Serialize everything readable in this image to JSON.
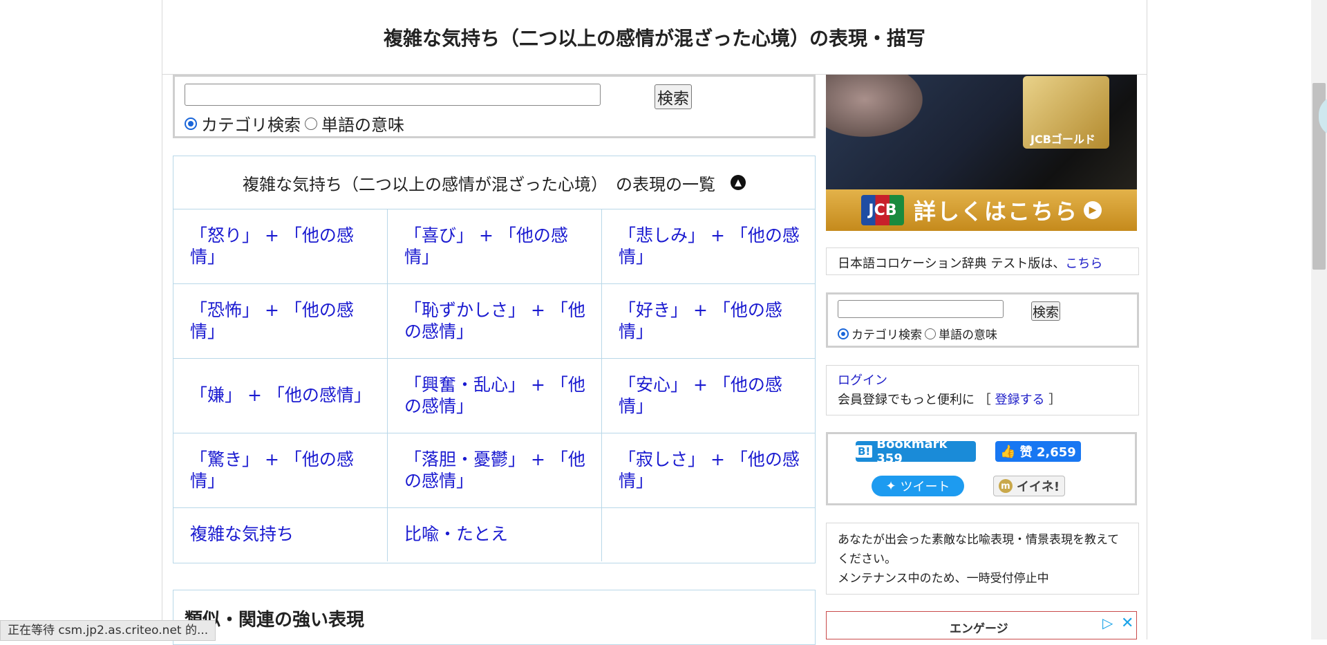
{
  "header": {
    "title": "複雑な気持ち（二つ以上の感情が混ざった心境）の表現・描写"
  },
  "search": {
    "button_label": "検索",
    "radio_category_label": "カテゴリ検索",
    "radio_word_label": "単語の意味",
    "selected": "カテゴリ検索"
  },
  "expression_list": {
    "caption": "複雑な気持ち（二つ以上の感情が混ざった心境）　の表現の一覧",
    "toggle_icon": "chevron-up-icon",
    "items": [
      "「怒り」 + 「他の感情」",
      "「喜び」 + 「他の感情」",
      "「悲しみ」 + 「他の感情」",
      "「恐怖」 + 「他の感情」",
      "「恥ずかしさ」 + 「他の感情」",
      "「好き」 + 「他の感情」",
      "「嫌」 + 「他の感情」",
      "「興奮・乱心」 + 「他の感情」",
      "「安心」 + 「他の感情」",
      "「驚き」 + 「他の感情」",
      "「落胆・憂鬱」 + 「他の感情」",
      "「寂しさ」 + 「他の感情」",
      "複雑な気持ち",
      "比喩・たとえ",
      ""
    ]
  },
  "related": {
    "heading": "類似・関連の強い表現"
  },
  "sidebar": {
    "ad_banner": {
      "card_text": "JCBゴールド",
      "logo_text": "JCB",
      "cta": "詳しくはこちら"
    },
    "collocation": {
      "text": "日本語コロケーション辞典 テスト版は、",
      "link": "こちら"
    },
    "search": {
      "button_label": "検索",
      "radio_category_label": "カテゴリ検索",
      "radio_word_label": "単語の意味"
    },
    "login": {
      "link": "ログイン",
      "prefix": "会員登録でもっと便利に ［",
      "register_link": "登録する",
      "suffix": "］"
    },
    "social": {
      "hatena_label": "Bookmark 359",
      "fb_label": "赞 2,659",
      "tweet_label": "ツイート",
      "mixi_label": "イイネ!"
    },
    "submit": {
      "line1": "あなたが出会った素敵な比喩表現・情景表現を教えてください。",
      "line2": "メンテナンス中のため、一時受付停止中"
    },
    "ad_bottom": {
      "label": "エンゲージ"
    }
  },
  "status_bar": {
    "text": "正在等待 csm.jp2.as.criteo.net 的..."
  },
  "colors": {
    "link": "#1a1ad0",
    "table_border": "#b8d7e8",
    "radio_selected": "#1a66d9",
    "hatena": "#1a8bd8",
    "facebook": "#1877f2",
    "twitter": "#1d9bf0"
  }
}
